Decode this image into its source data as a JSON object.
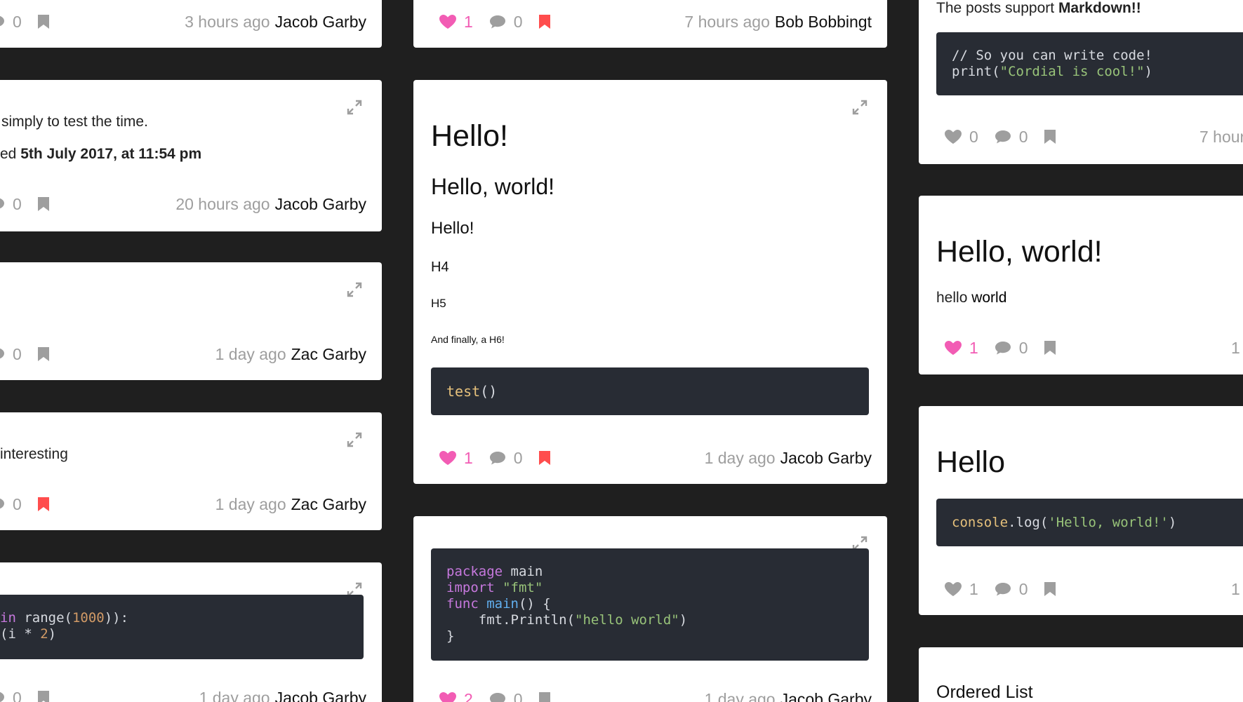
{
  "col1": {
    "c1": {
      "comments": "0",
      "time": "3 hours ago",
      "author": "Jacob Garby"
    },
    "c2": {
      "line1": "simply to test the time.",
      "line2_prefix": "ed",
      "line2_bold": "5th July 2017, at 11:54 pm",
      "comments": "0",
      "time": "20 hours ago",
      "author": "Jacob Garby"
    },
    "c3": {
      "comments": "0",
      "time": "1 day ago",
      "author": "Zac Garby"
    },
    "c4": {
      "text": "interesting",
      "comments": "0",
      "time": "1 day ago",
      "author": "Zac Garby"
    },
    "c5": {
      "code_l1_a": "in",
      "code_l1_b": " range(",
      "code_l1_num": "1000",
      "code_l1_c": ")):",
      "code_l2_a": "(i * ",
      "code_l2_num": "2",
      "code_l2_b": ")",
      "comments": "0",
      "time": "1 day ago",
      "author": "Jacob Garby"
    }
  },
  "col2": {
    "c1": {
      "likes": "1",
      "comments": "0",
      "time": "7 hours ago",
      "author": "Bob Bobbingt"
    },
    "c2": {
      "h1": "Hello!",
      "h2": "Hello, world!",
      "h3": "Hello!",
      "h4": "H4",
      "h5": "H5",
      "h6": "And finally, a H6!",
      "code_fn": "test",
      "code_rest": "()",
      "likes": "1",
      "comments": "0",
      "time": "1 day ago",
      "author": "Jacob Garby"
    },
    "c3": {
      "k1": "package",
      "t1": " main",
      "k2": "import",
      "s2": " \"fmt\"",
      "k3": "func",
      "f3": " main",
      "t3": "() {",
      "t4": "    fmt.Println(",
      "s4": "\"hello world\"",
      "t4b": ")",
      "t5": "}",
      "likes": "2",
      "comments": "0",
      "time": "1 day ago",
      "author": "Jacob Garby"
    }
  },
  "col3": {
    "c1": {
      "intro": "The posts support ",
      "intro_bold": "Markdown!!",
      "code_comment": "// So you can write code!",
      "code_fn": "print(",
      "code_str": "\"Cordial is cool!\"",
      "code_end": ")",
      "likes": "0",
      "comments": "0",
      "time": "7 hour"
    },
    "c2": {
      "title": "Hello, world!",
      "text_a": "hello ",
      "text_b": "world",
      "likes": "1",
      "comments": "0",
      "time": "1"
    },
    "c3": {
      "title": "Hello",
      "code_a": "console",
      "code_b": ".log(",
      "code_str": "'Hello, world!'",
      "code_c": ")",
      "likes": "1",
      "comments": "0",
      "time": "1"
    },
    "c4": {
      "title": "Ordered List"
    }
  },
  "colors": {
    "like": "#f25cb4",
    "bookmark_active": "#ff4d4d",
    "muted": "#9e9e9e",
    "code_bg": "#282c34",
    "page_bg": "#1f1f1f"
  }
}
